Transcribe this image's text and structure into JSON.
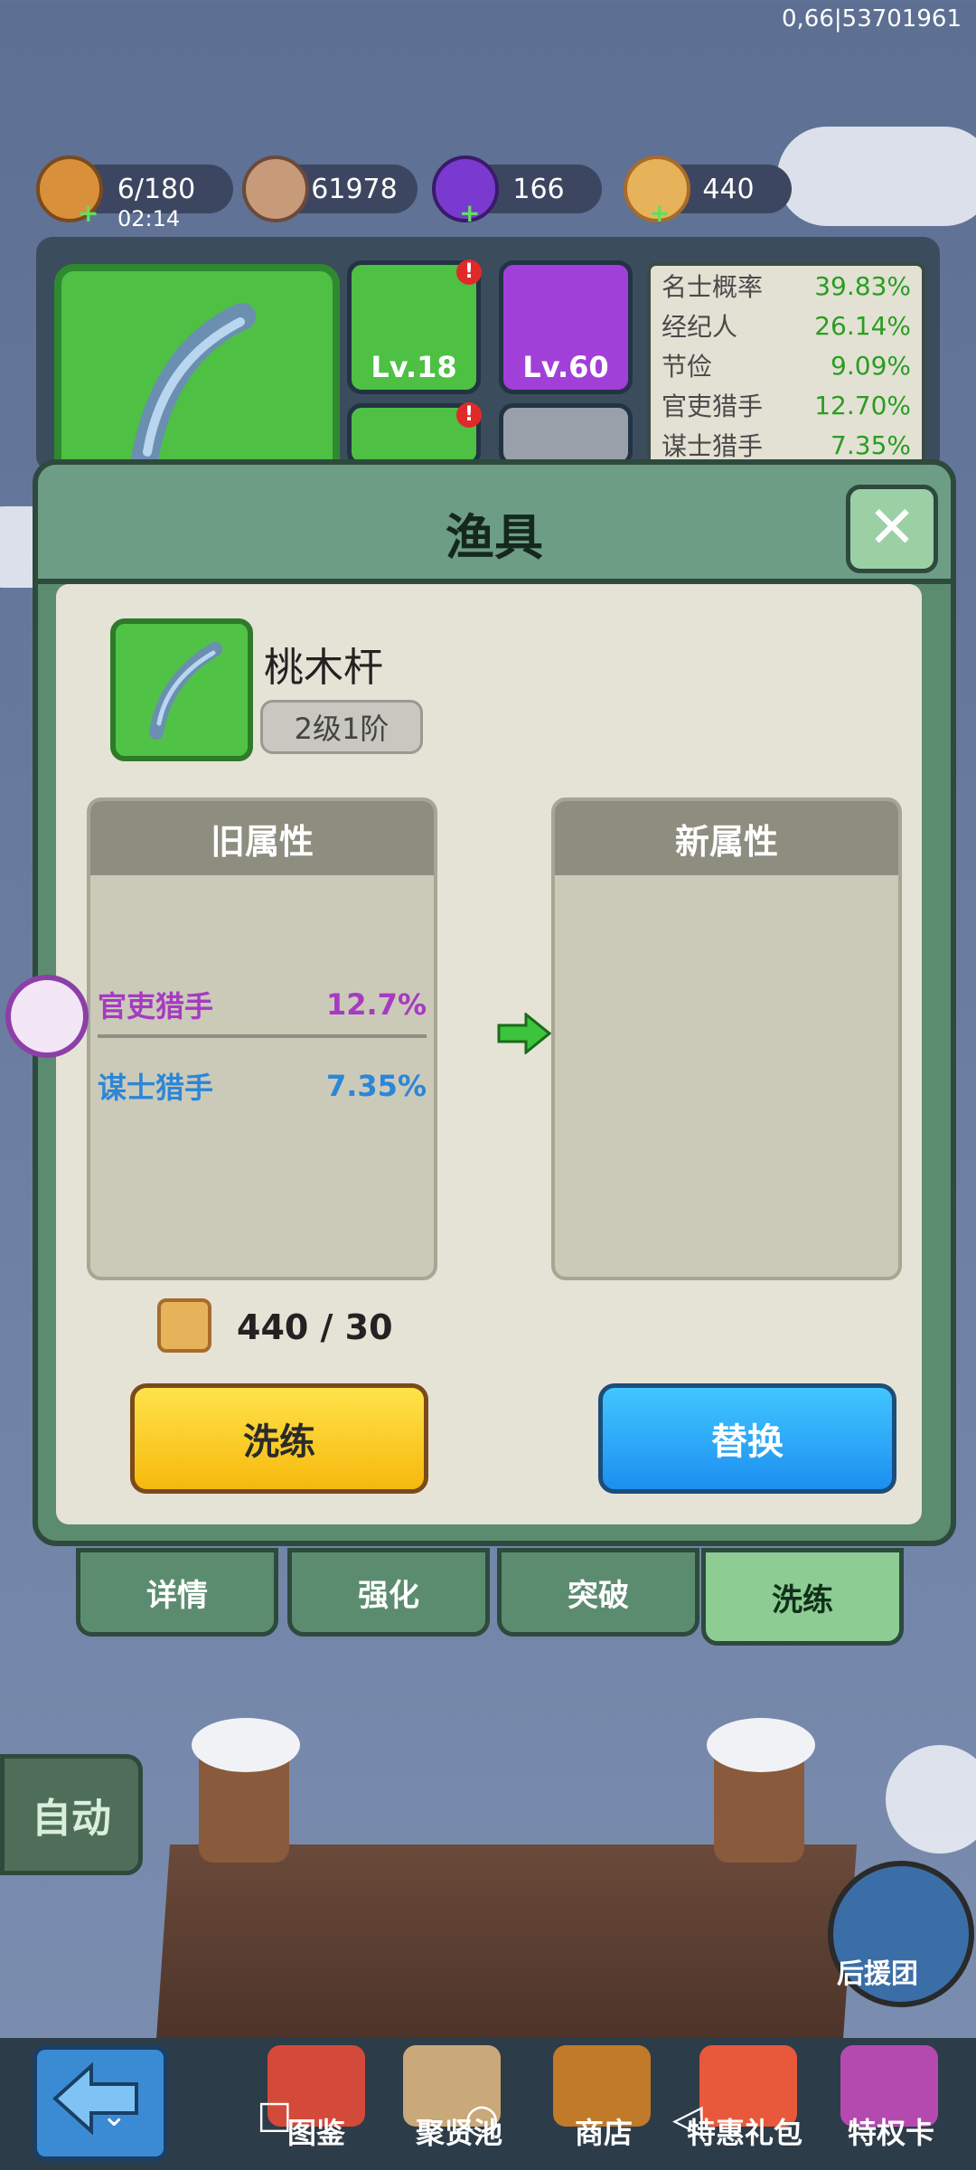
{
  "status_bar": {
    "right_text": "0,66|53701961"
  },
  "resources": [
    {
      "name": "stamina",
      "value": "6/180",
      "timer": "02:14",
      "icon": "bread-icon"
    },
    {
      "name": "coins",
      "value": "61978",
      "icon": "coin-icon"
    },
    {
      "name": "gems",
      "value": "166",
      "icon": "purple-gem-icon"
    },
    {
      "name": "stones",
      "value": "440",
      "icon": "refine-stone-icon"
    }
  ],
  "equipment": {
    "slot_levels": [
      "Lv.18",
      "Lv.60"
    ]
  },
  "stats_panel": [
    {
      "name": "名士概率",
      "value": "39.83%"
    },
    {
      "name": "经纪人",
      "value": "26.14%"
    },
    {
      "name": "节俭",
      "value": "9.09%"
    },
    {
      "name": "官吏猎手",
      "value": "12.70%"
    },
    {
      "name": "谋士猎手",
      "value": "7.35%"
    }
  ],
  "modal": {
    "title": "渔具",
    "item_name": "桃木杆",
    "item_grade": "2级1阶",
    "old_attr_header": "旧属性",
    "new_attr_header": "新属性",
    "old_attrs": [
      {
        "name": "官吏猎手",
        "value": "12.7%",
        "color": "#a63bc2"
      },
      {
        "name": "谋士猎手",
        "value": "7.35%",
        "color": "#2c86d8"
      }
    ],
    "cost": "440 / 30",
    "refine_button": "洗练",
    "replace_button": "替换"
  },
  "tabs": [
    {
      "label": "详情",
      "active": false
    },
    {
      "label": "强化",
      "active": false
    },
    {
      "label": "突破",
      "active": false
    },
    {
      "label": "洗练",
      "active": true
    }
  ],
  "auto_button": "自动",
  "support_label": "后援团",
  "bottom_nav": [
    {
      "label": "图鉴"
    },
    {
      "label": "聚贤池"
    },
    {
      "label": "商店"
    },
    {
      "label": "特惠礼包"
    },
    {
      "label": "特权卡"
    }
  ]
}
